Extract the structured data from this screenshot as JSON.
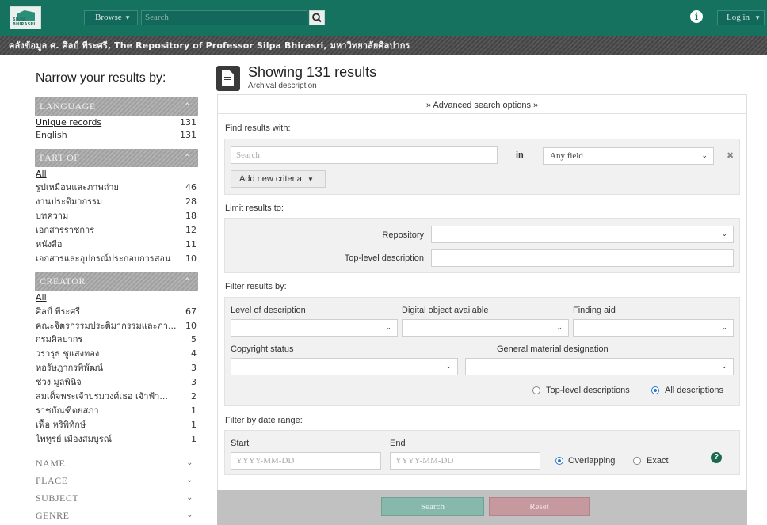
{
  "topbar": {
    "logo_text": "SILPA BHIRASRI",
    "browse_label": "Browse",
    "search_placeholder": "Search",
    "login_label": "Log in"
  },
  "banner": {
    "text": "คลังข้อมูล ศ. ศิลป์ พีระศรี, The Repository of Professor Silpa Bhirasri, มหาวิทยาลัยศิลปากร"
  },
  "sidebar": {
    "title": "Narrow your results by:",
    "language": {
      "header": "LANGUAGE",
      "items": [
        {
          "label": "Unique records",
          "count": "131"
        },
        {
          "label": "English",
          "count": "131"
        }
      ]
    },
    "part_of": {
      "header": "PART OF",
      "items": [
        {
          "label": "All",
          "count": ""
        },
        {
          "label": "รูปเหมือนและภาพถ่าย",
          "count": "46"
        },
        {
          "label": "งานประติมากรรม",
          "count": "28"
        },
        {
          "label": "บทความ",
          "count": "18"
        },
        {
          "label": "เอกสารราชการ",
          "count": "12"
        },
        {
          "label": "หนังสือ",
          "count": "11"
        },
        {
          "label": "เอกสารและอุปกรณ์ประกอบการสอน",
          "count": "10"
        }
      ]
    },
    "creator": {
      "header": "CREATOR",
      "items": [
        {
          "label": "All",
          "count": ""
        },
        {
          "label": "ศิลป์ พีระศรี",
          "count": "67"
        },
        {
          "label": "คณะจิตรกรรมประติมากรรมและภา...",
          "count": "10"
        },
        {
          "label": "กรมศิลปากร",
          "count": "5"
        },
        {
          "label": "วรารุธ ชูแสงทอง",
          "count": "4"
        },
        {
          "label": "หอรัษฎากรพิพัฒน์",
          "count": "3"
        },
        {
          "label": "ช่วง มูลพินิจ",
          "count": "3"
        },
        {
          "label": "สมเด็จพระเจ้าบรมวงศ์เธอ เจ้าฟ้า...",
          "count": "2"
        },
        {
          "label": "ราชบัณฑิตยสภา",
          "count": "1"
        },
        {
          "label": "เฟื้อ หริพิทักษ์",
          "count": "1"
        },
        {
          "label": "ไพทูรย์ เมืองสมบูรณ์",
          "count": "1"
        }
      ]
    },
    "collapsed": [
      "NAME",
      "PLACE",
      "SUBJECT",
      "GENRE"
    ]
  },
  "main": {
    "title": "Showing 131 results",
    "subtitle": "Archival description",
    "advanced_toggle": "Advanced search options",
    "find_label": "Find results with:",
    "search_placeholder": "Search",
    "in_label": "in",
    "field_select": "Any field",
    "add_criteria": "Add new criteria",
    "limit_label": "Limit results to:",
    "repository_label": "Repository",
    "toplevel_label": "Top-level description",
    "filter_label": "Filter results by:",
    "level_label": "Level of description",
    "digital_label": "Digital object available",
    "finding_label": "Finding aid",
    "copyright_label": "Copyright status",
    "gmd_label": "General material designation",
    "radio_toplevel": "Top-level descriptions",
    "radio_all": "All descriptions",
    "date_label": "Filter by date range:",
    "start_label": "Start",
    "end_label": "End",
    "date_placeholder": "YYYY-MM-DD",
    "radio_overlapping": "Overlapping",
    "radio_exact": "Exact",
    "search_button": "Search",
    "reset_button": "Reset"
  },
  "colors": {
    "topbar": "#14725f",
    "link": "#1e7a63",
    "search_button": "#86b9ab",
    "reset_button": "#c5999d"
  }
}
